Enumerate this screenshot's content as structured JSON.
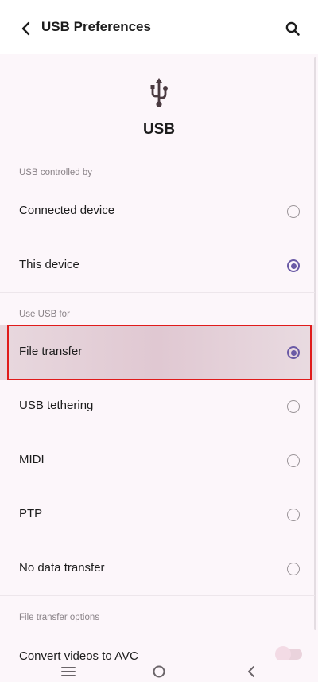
{
  "appbar": {
    "title": "USB Preferences",
    "back_icon": "chevron-left-icon",
    "search_icon": "search-icon"
  },
  "header": {
    "icon": "usb-icon",
    "title": "USB"
  },
  "sections": {
    "controlled_by": {
      "label": "USB controlled by",
      "options": [
        {
          "label": "Connected device",
          "checked": false
        },
        {
          "label": "This device",
          "checked": true
        }
      ]
    },
    "use_for": {
      "label": "Use USB for",
      "options": [
        {
          "label": "File transfer",
          "checked": true
        },
        {
          "label": "USB tethering",
          "checked": false
        },
        {
          "label": "MIDI",
          "checked": false
        },
        {
          "label": "PTP",
          "checked": false
        },
        {
          "label": "No data transfer",
          "checked": false
        }
      ]
    },
    "file_transfer_options": {
      "label": "File transfer options",
      "items": [
        {
          "label": "Convert videos to AVC",
          "toggle": false
        }
      ]
    }
  },
  "colors": {
    "accent": "#6a5aa6",
    "highlight_border": "#e01b1b"
  },
  "navbar": {
    "items": [
      "menu-icon",
      "home-icon",
      "back-icon"
    ]
  }
}
